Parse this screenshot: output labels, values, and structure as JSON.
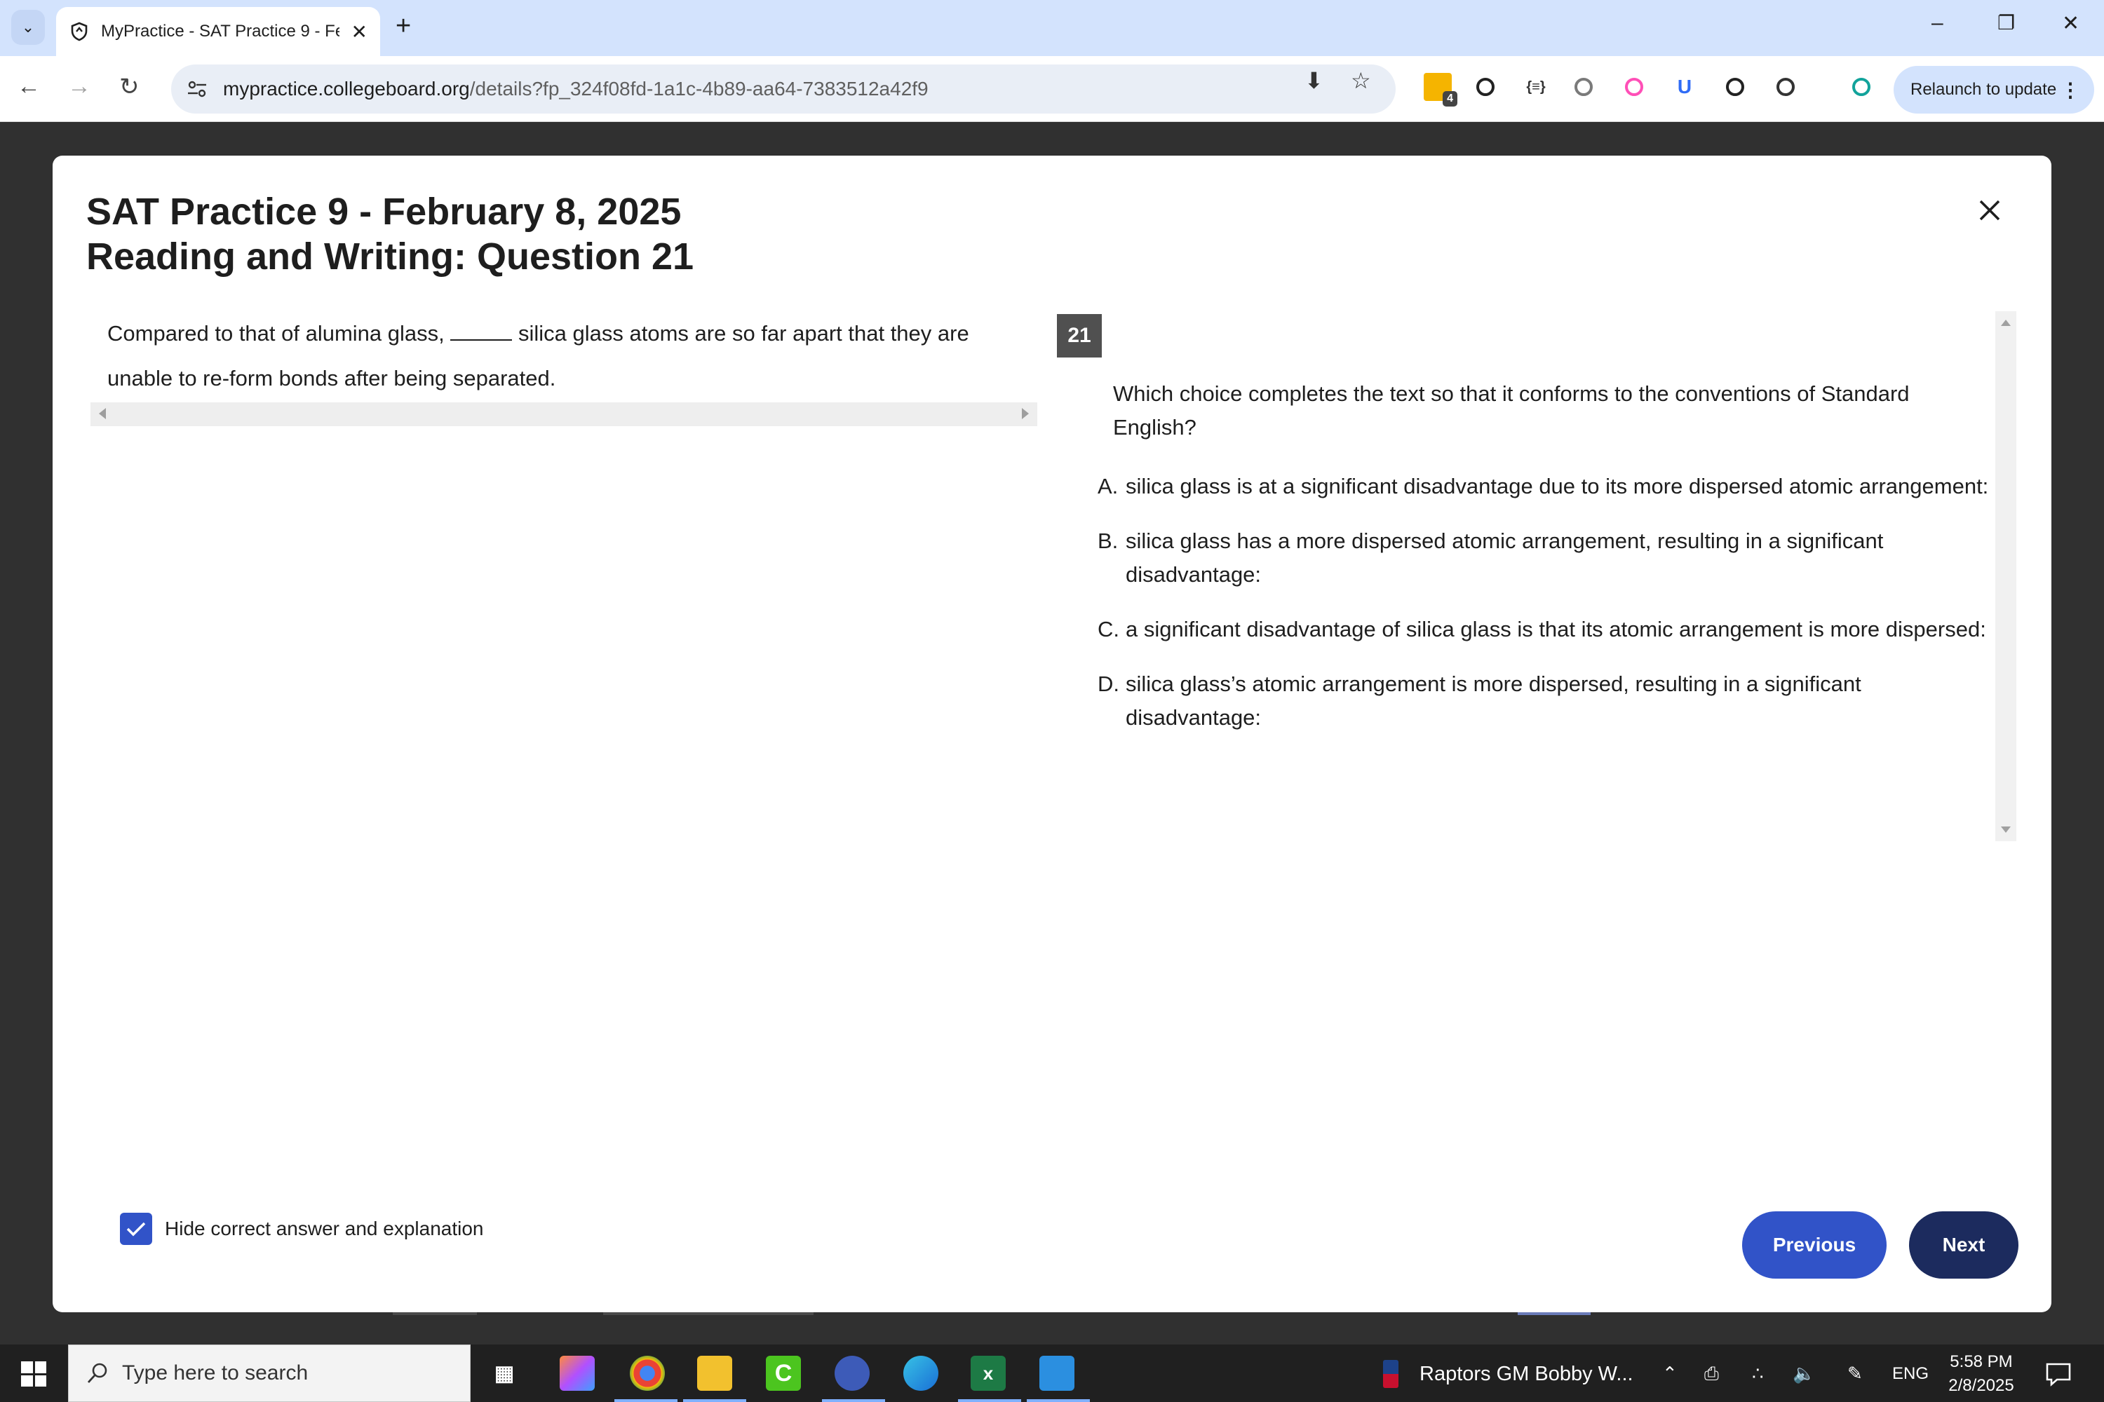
{
  "browser": {
    "tab": {
      "title": "MyPractice - SAT Practice 9 - February 8, 2025"
    },
    "url": {
      "domain": "mypractice.collegeboard.org",
      "path": "/details?fp_324f08fd-1a1c-4b89-aa64-7383512a42f9"
    },
    "extensions": [
      {
        "name": "notes-extension-icon",
        "badge": "4",
        "color": "#f5b400"
      },
      {
        "name": "owl-extension-icon",
        "glyph": "",
        "color": "#222222"
      },
      {
        "name": "json-extension-icon",
        "glyph": "{≡}",
        "color": "#333333"
      },
      {
        "name": "refresh-c-extension-icon",
        "glyph": "",
        "color": "#7a7a7a"
      },
      {
        "name": "pink-arrow-extension-icon",
        "glyph": "",
        "color": "#ff4fb7"
      },
      {
        "name": "u-shield-extension-icon",
        "glyph": "U",
        "color": "#2f6cf6"
      },
      {
        "name": "eyedropper-icon",
        "glyph": "",
        "color": "#222222"
      },
      {
        "name": "puzzle-extensions-icon",
        "glyph": "",
        "color": "#333333"
      },
      {
        "name": "bars-extension-icon",
        "glyph": "",
        "color": "#12a39b"
      }
    ],
    "relaunch_label": "Relaunch to update"
  },
  "modal": {
    "title_line1": "SAT Practice 9 - February 8, 2025",
    "title_line2": "Reading and Writing: Question 21",
    "passage_before": "Compared to that of alumina glass,",
    "passage_after": "silica glass atoms are so far apart that they are unable to re-form bonds after being separated.",
    "question_number": "21",
    "question": "Which choice completes the text so that it conforms to the conventions of Standard English?",
    "choices": [
      {
        "letter": "A.",
        "text": "silica glass is at a significant disadvantage due to its more dispersed atomic arrangement:"
      },
      {
        "letter": "B.",
        "text": "silica glass has a more dispersed atomic arrangement, resulting in a significant disadvantage:"
      },
      {
        "letter": "C.",
        "text": "a significant disadvantage of silica glass is that its atomic arrangement is more dispersed:"
      },
      {
        "letter": "D.",
        "text": "silica glass’s atomic arrangement is more dispersed, resulting in a significant disadvantage:"
      }
    ],
    "hide_answer_label": "Hide correct answer and explanation",
    "hide_answer_checked": true,
    "previous_label": "Previous",
    "next_label": "Next"
  },
  "taskbar": {
    "search_placeholder": "Type here to search",
    "news_text": "Raptors GM Bobby W...",
    "language": "ENG",
    "time": "5:58 PM",
    "date": "2/8/2025"
  },
  "colors": {
    "primary_button": "#3153c8",
    "next_button": "#1c2b5e",
    "tab_strip": "#d3e3fd"
  }
}
